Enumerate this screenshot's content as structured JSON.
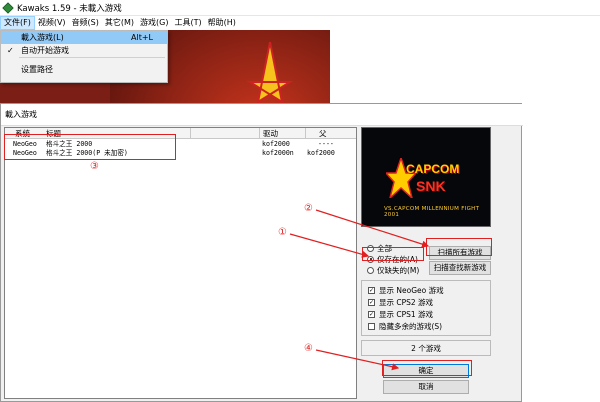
{
  "window": {
    "title": "Kawaks 1.59 - 未載入游戏"
  },
  "menubar": {
    "items": [
      "文件(F)",
      "视频(V)",
      "音频(S)",
      "其它(M)",
      "游戏(G)",
      "工具(T)",
      "帮助(H)"
    ]
  },
  "file_menu": {
    "load_game": {
      "label": "載入游戏(L)",
      "accel": "Alt+L"
    },
    "autostart": {
      "label": "自动开始游戏",
      "check": "✓"
    },
    "set_path": {
      "label": "设置路径"
    }
  },
  "dialog": {
    "title": "載入游戏",
    "columns": [
      "系统",
      "标题",
      "驱动",
      "父"
    ],
    "rows": [
      {
        "system": "NeoGeo",
        "title": "格斗之王 2000",
        "driver": "kof2000",
        "parent": "----"
      },
      {
        "system": "NeoGeo",
        "title": "格斗之王 2000(P 未加密)",
        "driver": "kof2000n",
        "parent": "kof2000"
      }
    ],
    "logo": {
      "capcom": "CAPCOM",
      "snk": "SNK",
      "subtitle": "VS.CAPCOM MILLENNIUM FIGHT 2001"
    },
    "filter": {
      "all": "全部",
      "available": "仅存在的(A)",
      "missing": "仅缺失的(M)"
    },
    "buttons": {
      "scan_all": "扫描所有游戏",
      "scan_new": "扫描查找新游戏",
      "ok": "确定",
      "cancel": "取消"
    },
    "options": [
      {
        "label": "显示 NeoGeo 游戏",
        "checked": true
      },
      {
        "label": "显示 CPS2 游戏",
        "checked": true
      },
      {
        "label": "显示 CPS1 游戏",
        "checked": true
      },
      {
        "label": "隐藏多余的游戏(S)",
        "checked": false
      }
    ],
    "game_count": "2 个游戏"
  },
  "annotations": {
    "a1": "①",
    "a2": "②",
    "a3": "③",
    "a4": "④"
  },
  "colors": {
    "annotation": "#e02020",
    "highlight": "#91c9f7"
  }
}
